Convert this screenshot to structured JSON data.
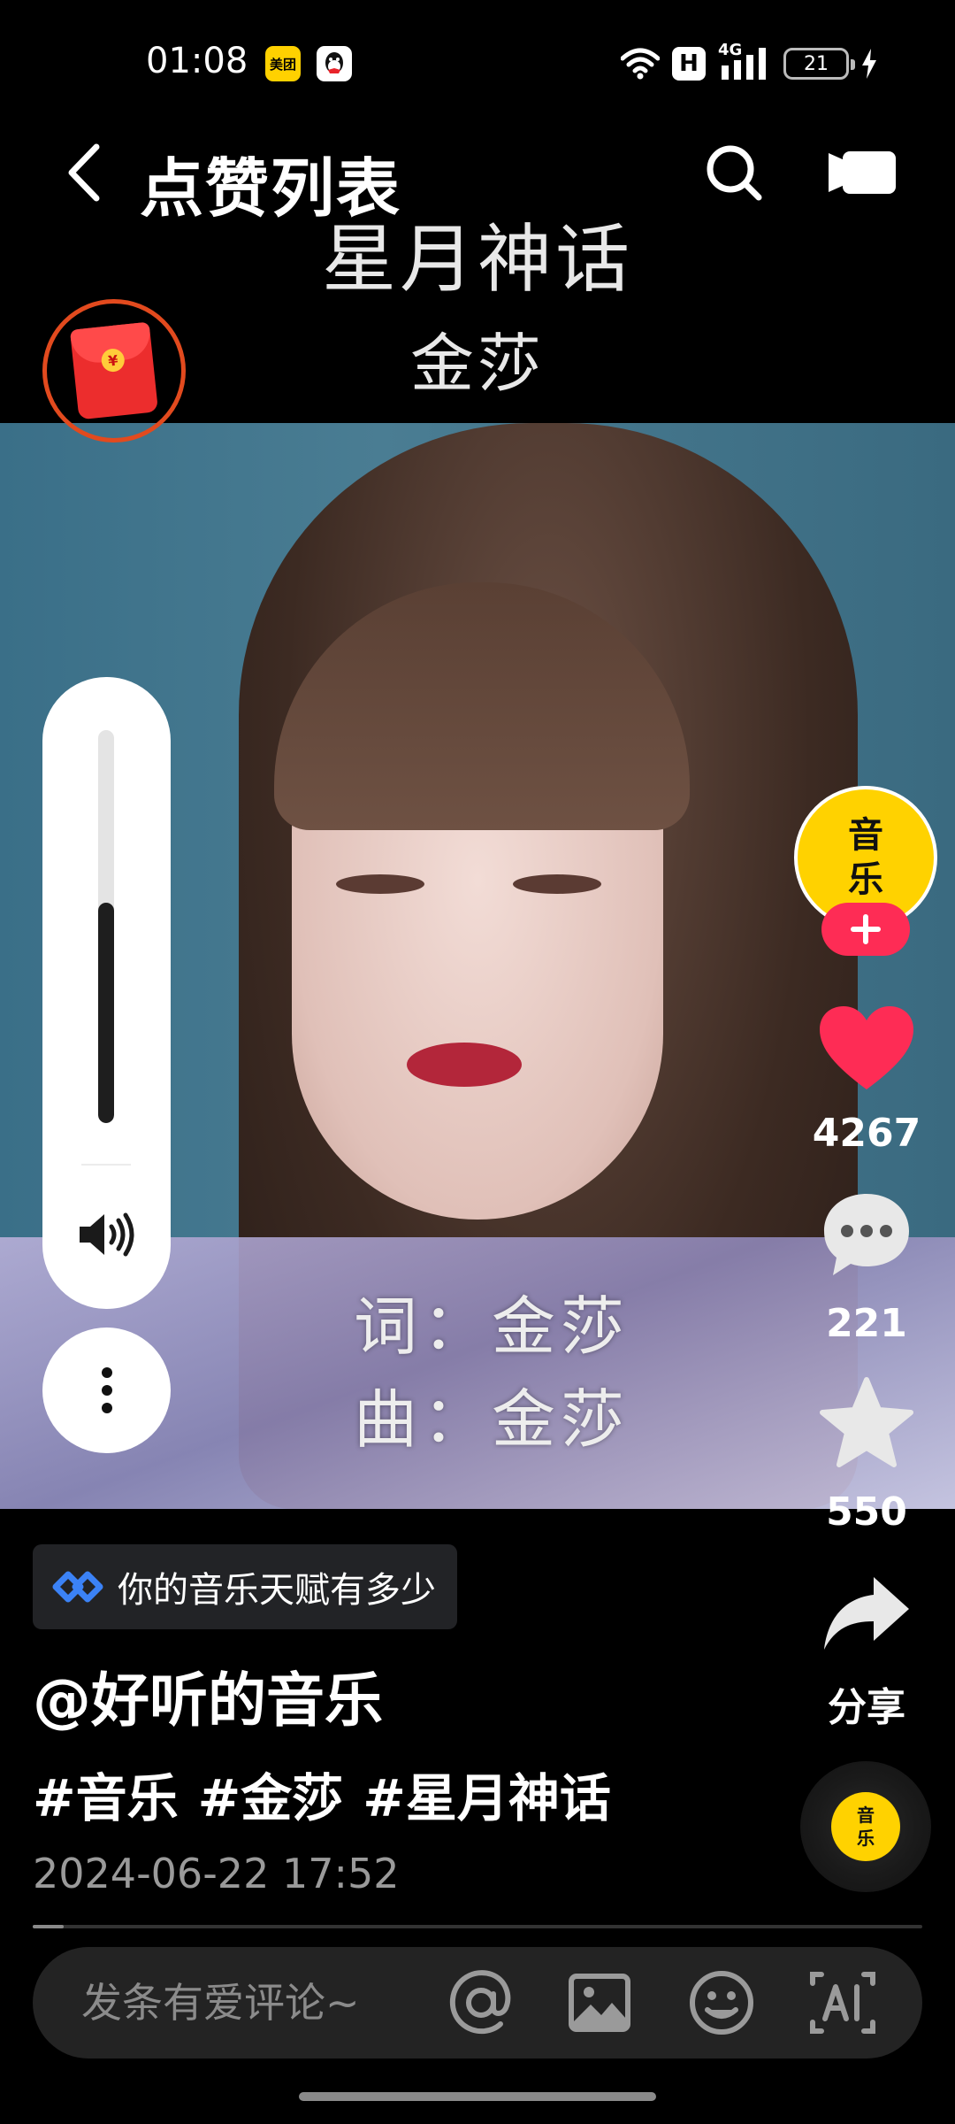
{
  "status_bar": {
    "time": "01:08",
    "meituan_label": "美团",
    "network": "4G",
    "h_label": "H",
    "battery": "21"
  },
  "header": {
    "title": "点赞列表"
  },
  "video": {
    "song_title": "星月神话",
    "artist": "金莎",
    "lyric_line_1": "词：金莎",
    "lyric_line_2": "曲：金莎"
  },
  "volume": {
    "level": 0.56
  },
  "rail": {
    "avatar_text_1": "音",
    "avatar_text_2": "乐",
    "like_count": "4267",
    "comment_count": "221",
    "favorite_count": "550",
    "share_label": "分享",
    "disc_text_1": "音",
    "disc_text_2": "乐"
  },
  "info": {
    "tag_chip": "你的音乐天赋有多少",
    "author": "@好听的音乐",
    "hashtags": [
      "#音乐",
      "#金莎",
      "#星月神话"
    ],
    "date": "2024-06-22 17:52",
    "progress": 0.035
  },
  "comment_bar": {
    "placeholder": "发条有爱评论~"
  },
  "colors": {
    "like_red": "#fe2c55",
    "avatar_yellow": "#ffd200",
    "tag_blue": "#3b82f6"
  },
  "icons": [
    "back-icon",
    "search-icon",
    "video-camera-icon",
    "red-packet-icon",
    "speaker-icon",
    "more-vertical-icon",
    "plus-icon",
    "heart-icon",
    "comment-icon",
    "star-icon",
    "share-icon",
    "at-icon",
    "image-icon",
    "emoji-icon",
    "ai-icon"
  ]
}
